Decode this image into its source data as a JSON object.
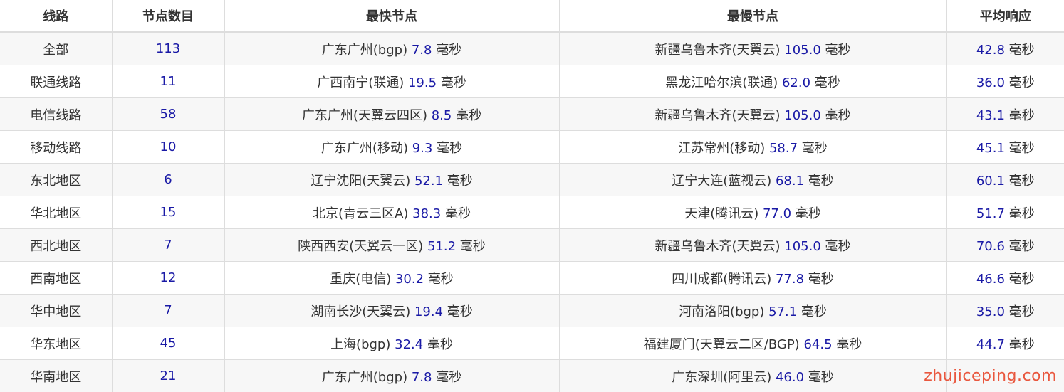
{
  "table": {
    "headers": [
      "线路",
      "节点数目",
      "最快节点",
      "最慢节点",
      "平均响应"
    ],
    "unit": "毫秒",
    "rows": [
      {
        "line": "全部",
        "count": "113",
        "fastest": {
          "name": "广东广州(bgp)",
          "ms": "7.8"
        },
        "slowest": {
          "name": "新疆乌鲁木齐(天翼云)",
          "ms": "105.0"
        },
        "avg": "42.8"
      },
      {
        "line": "联通线路",
        "count": "11",
        "fastest": {
          "name": "广西南宁(联通)",
          "ms": "19.5"
        },
        "slowest": {
          "name": "黑龙江哈尔滨(联通)",
          "ms": "62.0"
        },
        "avg": "36.0"
      },
      {
        "line": "电信线路",
        "count": "58",
        "fastest": {
          "name": "广东广州(天翼云四区)",
          "ms": "8.5"
        },
        "slowest": {
          "name": "新疆乌鲁木齐(天翼云)",
          "ms": "105.0"
        },
        "avg": "43.1"
      },
      {
        "line": "移动线路",
        "count": "10",
        "fastest": {
          "name": "广东广州(移动)",
          "ms": "9.3"
        },
        "slowest": {
          "name": "江苏常州(移动)",
          "ms": "58.7"
        },
        "avg": "45.1"
      },
      {
        "line": "东北地区",
        "count": "6",
        "fastest": {
          "name": "辽宁沈阳(天翼云)",
          "ms": "52.1"
        },
        "slowest": {
          "name": "辽宁大连(蓝视云)",
          "ms": "68.1"
        },
        "avg": "60.1"
      },
      {
        "line": "华北地区",
        "count": "15",
        "fastest": {
          "name": "北京(青云三区A)",
          "ms": "38.3"
        },
        "slowest": {
          "name": "天津(腾讯云)",
          "ms": "77.0"
        },
        "avg": "51.7"
      },
      {
        "line": "西北地区",
        "count": "7",
        "fastest": {
          "name": "陕西西安(天翼云一区)",
          "ms": "51.2"
        },
        "slowest": {
          "name": "新疆乌鲁木齐(天翼云)",
          "ms": "105.0"
        },
        "avg": "70.6"
      },
      {
        "line": "西南地区",
        "count": "12",
        "fastest": {
          "name": "重庆(电信)",
          "ms": "30.2"
        },
        "slowest": {
          "name": "四川成都(腾讯云)",
          "ms": "77.8"
        },
        "avg": "46.6"
      },
      {
        "line": "华中地区",
        "count": "7",
        "fastest": {
          "name": "湖南长沙(天翼云)",
          "ms": "19.4"
        },
        "slowest": {
          "name": "河南洛阳(bgp)",
          "ms": "57.1"
        },
        "avg": "35.0"
      },
      {
        "line": "华东地区",
        "count": "45",
        "fastest": {
          "name": "上海(bgp)",
          "ms": "32.4"
        },
        "slowest": {
          "name": "福建厦门(天翼云二区/BGP)",
          "ms": "64.5"
        },
        "avg": "44.7"
      },
      {
        "line": "华南地区",
        "count": "21",
        "fastest": {
          "name": "广东广州(bgp)",
          "ms": "7.8"
        },
        "slowest": {
          "name": "广东深圳(阿里云)",
          "ms": "46.0"
        },
        "avg": ""
      }
    ]
  },
  "watermark": "zhujiceping.com",
  "colors": {
    "number": "#1a1aa6",
    "text": "#333333",
    "stripe": "#f7f7f7",
    "border": "#dddddd",
    "watermark": "#e8462b"
  }
}
